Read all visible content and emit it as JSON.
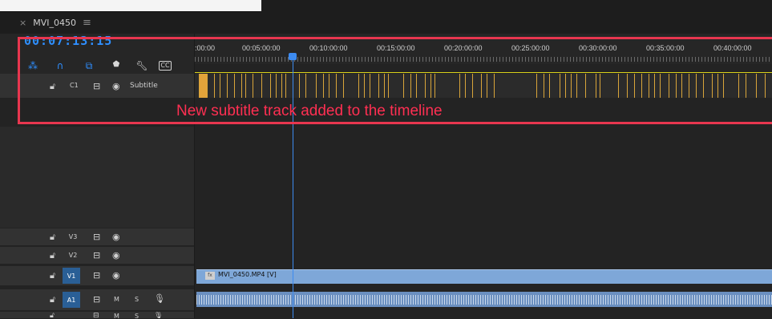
{
  "window": {
    "tab_title": "MVI_0450",
    "close_glyph": "×",
    "menu_glyph": "≡"
  },
  "timecode": "00:07:13:15",
  "ruler": {
    "labels": [
      ":00:00",
      "00:05:00:00",
      "00:10:00:00",
      "00:15:00:00",
      "00:20:00:00",
      "00:25:00:00",
      "00:30:00:00",
      "00:35:00:00",
      "00:40:00:00"
    ]
  },
  "toolbar": {
    "icons": [
      "snap-icon",
      "magnet-icon",
      "linked-selection-icon",
      "marker-icon",
      "wrench-icon",
      "captions-icon"
    ],
    "captions_label": "CC"
  },
  "tracks": {
    "subtitle": {
      "id": "C1",
      "name": "Subtitle"
    },
    "v3": {
      "id": "V3"
    },
    "v2": {
      "id": "V2"
    },
    "v1": {
      "id": "V1"
    },
    "a1": {
      "id": "A1",
      "mute": "M",
      "solo": "S"
    },
    "a2": {
      "mute": "M",
      "solo": "S"
    }
  },
  "clips": {
    "v1_name": "MVI_0450.MP4 [V]",
    "fx_badge": "fx"
  },
  "annotation": {
    "text": "New subtitle track added to the timeline",
    "color": "#ff2f52"
  },
  "colors": {
    "timecode": "#2f8fff",
    "playhead": "#3d8bf0",
    "captions": "#d9a53a",
    "video_clip": "#7ea7d8",
    "audio_clip": "#6a8fc0",
    "highlight": "#e8364f"
  }
}
